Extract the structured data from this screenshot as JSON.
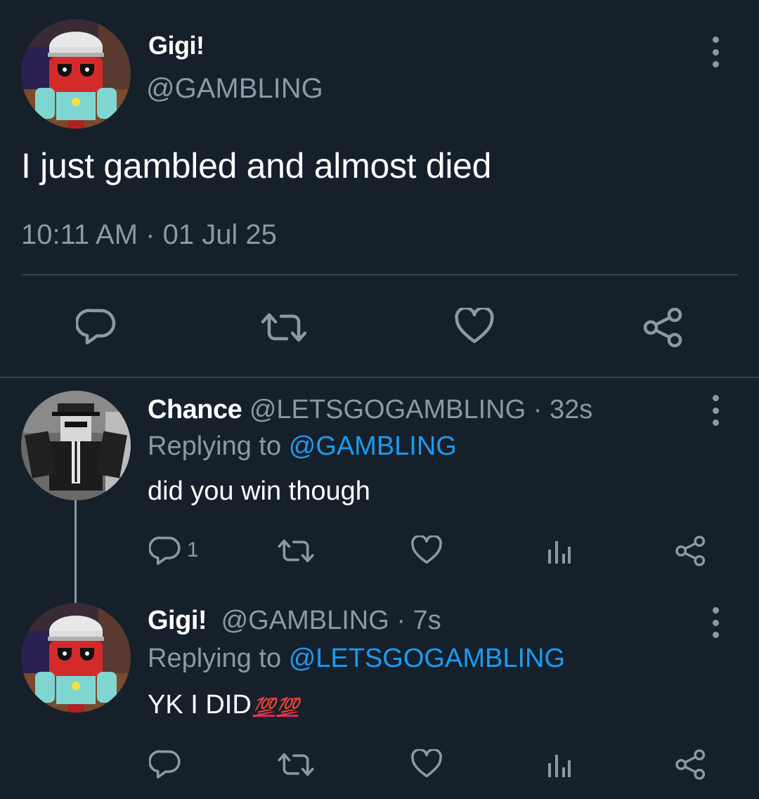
{
  "main_tweet": {
    "display_name": "Gigi!",
    "handle": "@GAMBLING",
    "text": "I just gambled and almost died",
    "timestamp": "10:11 AM · 01 Jul 25"
  },
  "replies": [
    {
      "display_name": "Chance",
      "handle": "@LETSGOGAMBLING",
      "time": "· 32s",
      "replying_prefix": "Replying to",
      "replying_to": "@GAMBLING",
      "text": "did you win though",
      "reply_count": "1"
    },
    {
      "display_name": "Gigi!",
      "handle": "@GAMBLING",
      "time": "· 7s",
      "replying_prefix": "Replying to",
      "replying_to": "@LETSGOGAMBLING",
      "text": "YK I DID",
      "emoji": [
        "💯",
        "💯"
      ]
    }
  ],
  "icons": {
    "reply": "reply-icon",
    "retweet": "retweet-icon",
    "like": "heart-icon",
    "share": "share-icon",
    "analytics": "analytics-icon",
    "more": "more-vertical-icon"
  },
  "colors": {
    "background": "#15202b",
    "text": "#ffffff",
    "secondary": "#8b98a5",
    "link": "#1d9bf0",
    "divider": "#38444d"
  }
}
